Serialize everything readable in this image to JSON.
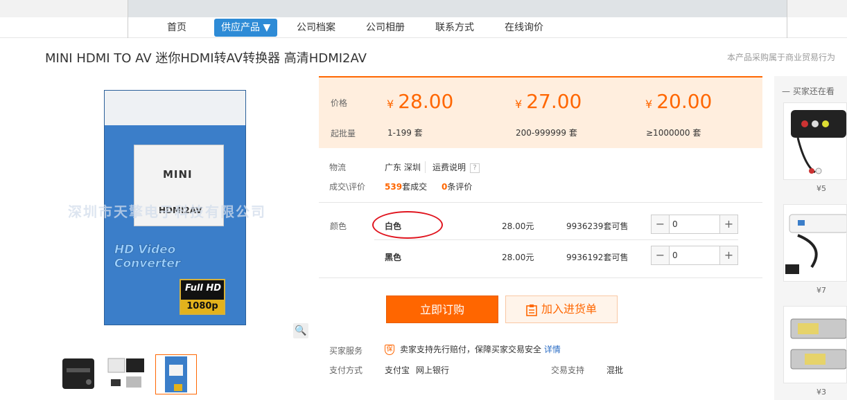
{
  "nav": {
    "items": [
      {
        "label": "首页",
        "active": false
      },
      {
        "label": "供应产品 ▼",
        "active": true
      },
      {
        "label": "公司档案",
        "active": false
      },
      {
        "label": "公司相册",
        "active": false
      },
      {
        "label": "联系方式",
        "active": false
      },
      {
        "label": "在线询价",
        "active": false
      }
    ]
  },
  "product": {
    "title": "MINI HDMI TO AV 迷你HDMI转AV转换器 高清HDMI2AV",
    "notice": "本产品采购属于商业贸易行为",
    "image": {
      "box_text": "MINI",
      "box_model": "HDMI2AV",
      "box_subtitle": "HD Video Converter",
      "badge_top": "Full HD",
      "badge_bottom": "1080p",
      "watermark": "深圳市天擎电子科技有限公司"
    }
  },
  "pricing": {
    "price_label": "价格",
    "moq_label": "起批量",
    "currency": "¥",
    "tiers": [
      {
        "price": "28.00",
        "range": "1-199 套"
      },
      {
        "price": "27.00",
        "range": "200-999999 套"
      },
      {
        "price": "20.00",
        "range": "≥1000000 套"
      }
    ]
  },
  "logistics": {
    "label": "物流",
    "location": "广东 深圳",
    "shipping_link": "运费说明",
    "help": "?"
  },
  "deals": {
    "label": "成交\\评价",
    "count": "539",
    "count_suffix": "套成交",
    "reviews": "0",
    "reviews_suffix": "条评价"
  },
  "variants": {
    "label": "颜色",
    "rows": [
      {
        "name": "白色",
        "price": "28.00元",
        "stock": "9936239套可售",
        "qty": "0",
        "highlighted": true
      },
      {
        "name": "黑色",
        "price": "28.00元",
        "stock": "9936192套可售",
        "qty": "0",
        "highlighted": false
      }
    ],
    "minus": "−",
    "plus": "+"
  },
  "actions": {
    "buy": "立即订购",
    "cart": "加入进货单"
  },
  "service": {
    "label": "买家服务",
    "text": "卖家支持先行赔付，保障买家交易安全",
    "detail_link": "详情"
  },
  "payment": {
    "label": "支付方式",
    "methods": [
      "支付宝",
      "网上银行"
    ],
    "trade_label": "交易支持",
    "trade_value": "混批"
  },
  "sidebar": {
    "title": "买家还在看",
    "items": [
      {
        "price": "¥5"
      },
      {
        "price": "¥7"
      },
      {
        "price": "¥3"
      }
    ]
  },
  "colors": {
    "accent": "#ff6600",
    "nav_active": "#2e8bd6",
    "highlight_ring": "#e0141e"
  }
}
